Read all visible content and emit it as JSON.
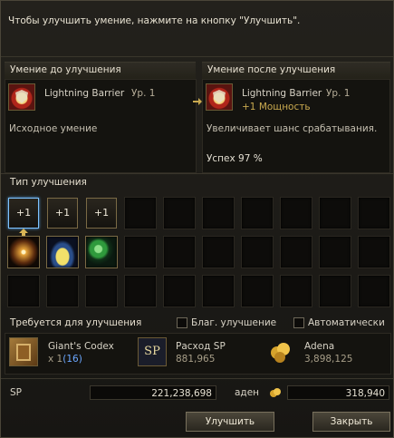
{
  "instruction": "Чтобы улучшить умение, нажмите на кнопку \"Улучшить\".",
  "before": {
    "header": "Умение до улучшения",
    "skill_name": "Lightning Barrier",
    "level": "Ур. 1",
    "description": "Исходное умение"
  },
  "after": {
    "header": "Умение после улучшения",
    "skill_name": "Lightning Barrier",
    "level": "Ур. 1",
    "bonus": "+1 Мощность",
    "description": "Увеличивает шанс срабатывания.",
    "success": "Успех 97 %"
  },
  "type": {
    "header": "Тип улучшения",
    "plus_labels": [
      "+1",
      "+1",
      "+1"
    ]
  },
  "required": {
    "header": "Требуется для улучшения",
    "blessed_label": "Благ. улучшение",
    "auto_label": "Автоматически",
    "items": [
      {
        "name": "Giant's Codex",
        "qty_prefix": "x 1",
        "qty_paren": "(16)"
      },
      {
        "name": "Расход SP",
        "value": "881,965",
        "icon_text": "SP"
      },
      {
        "name": "Adena",
        "value": "3,898,125"
      }
    ]
  },
  "sp": {
    "label": "SP",
    "value": "221,238,698"
  },
  "adena": {
    "label": "аден",
    "value": "318,940"
  },
  "buttons": {
    "upgrade": "Улучшить",
    "close": "Закрыть"
  },
  "colors": {
    "accent_gold": "#c9a94f",
    "qty_blue": "#6ba7ff",
    "selected_border": "#7ec3ff"
  }
}
